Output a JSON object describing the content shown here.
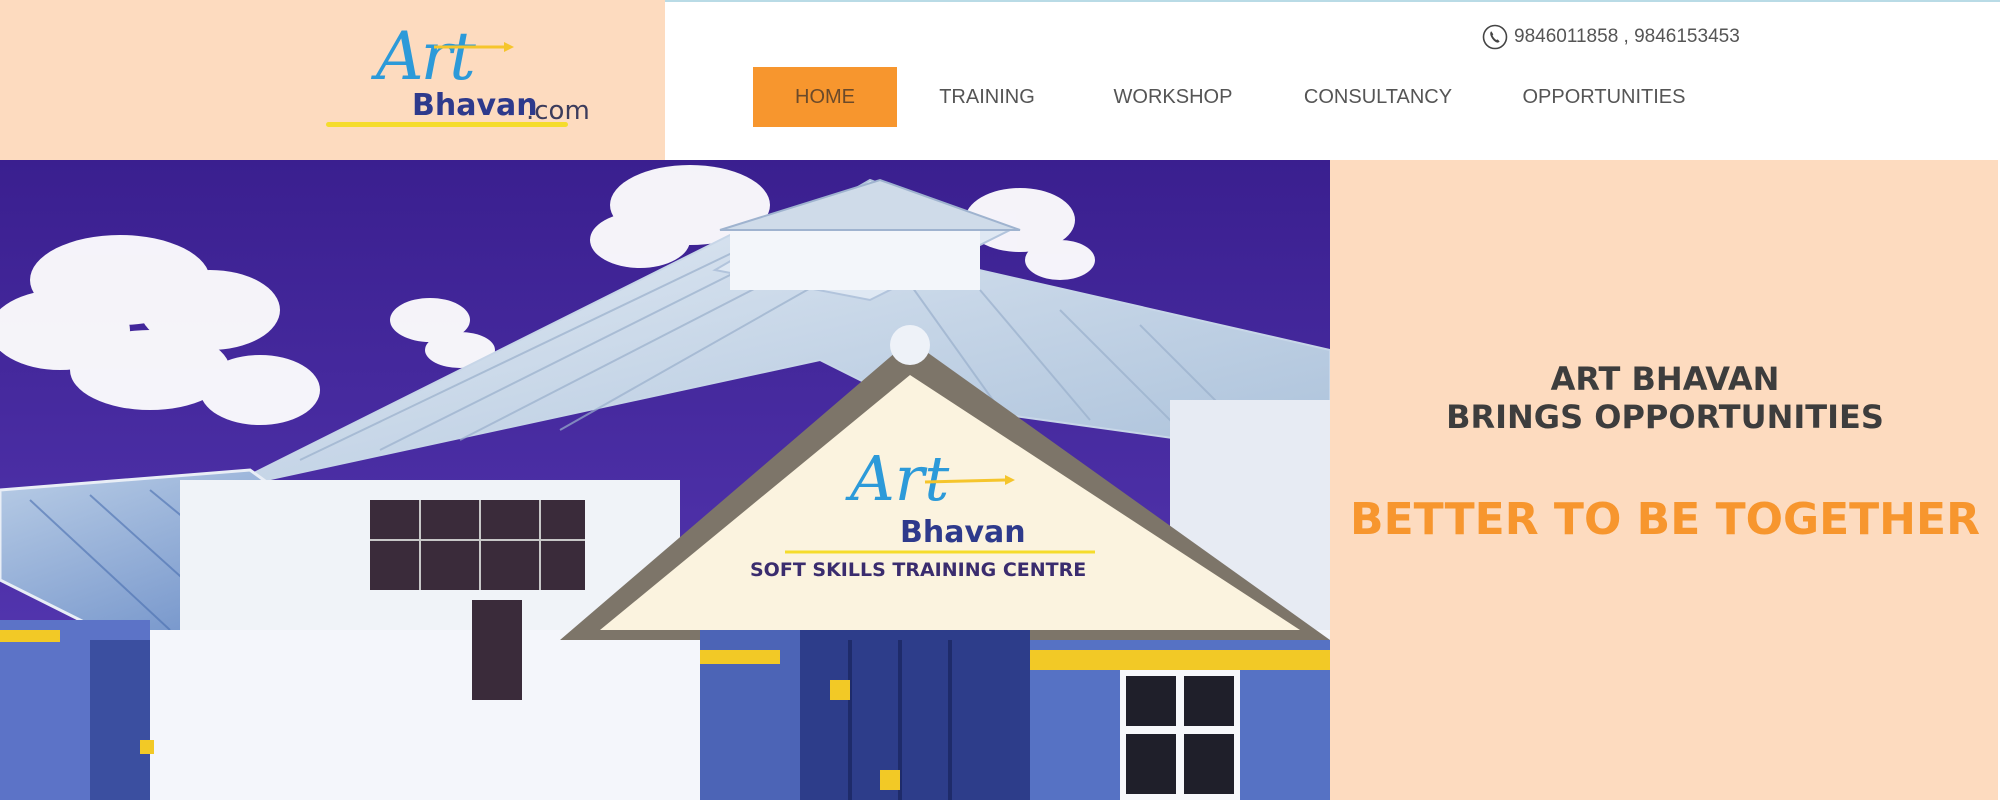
{
  "brand": {
    "logo_script": "Art",
    "logo_name": "Bhavan",
    "logo_suffix": ".com"
  },
  "contact": {
    "phone_text": "9846011858 , 9846153453",
    "icon": "phone-icon"
  },
  "nav": {
    "items": [
      {
        "label": "HOME",
        "active": true
      },
      {
        "label": "TRAINING",
        "active": false
      },
      {
        "label": "WORKSHOP",
        "active": false
      },
      {
        "label": "CONSULTANCY",
        "active": false
      },
      {
        "label": "OPPORTUNITIES",
        "active": false
      }
    ]
  },
  "hero": {
    "heading_line1": "ART BHAVAN",
    "heading_line2": "BRINGS OPPORTUNITIES",
    "tagline": "BETTER TO BE TOGETHER",
    "sign": {
      "logo_script": "Art",
      "logo_name": "Bhavan",
      "subtitle": "SOFT SKILLS TRAINING CENTRE"
    }
  },
  "colors": {
    "peach": "#fddbbf",
    "accent_orange": "#f7962e",
    "logo_blue": "#2c9ad9",
    "logo_navy": "#2e3a8c",
    "logo_yellow": "#f5dc2c"
  }
}
